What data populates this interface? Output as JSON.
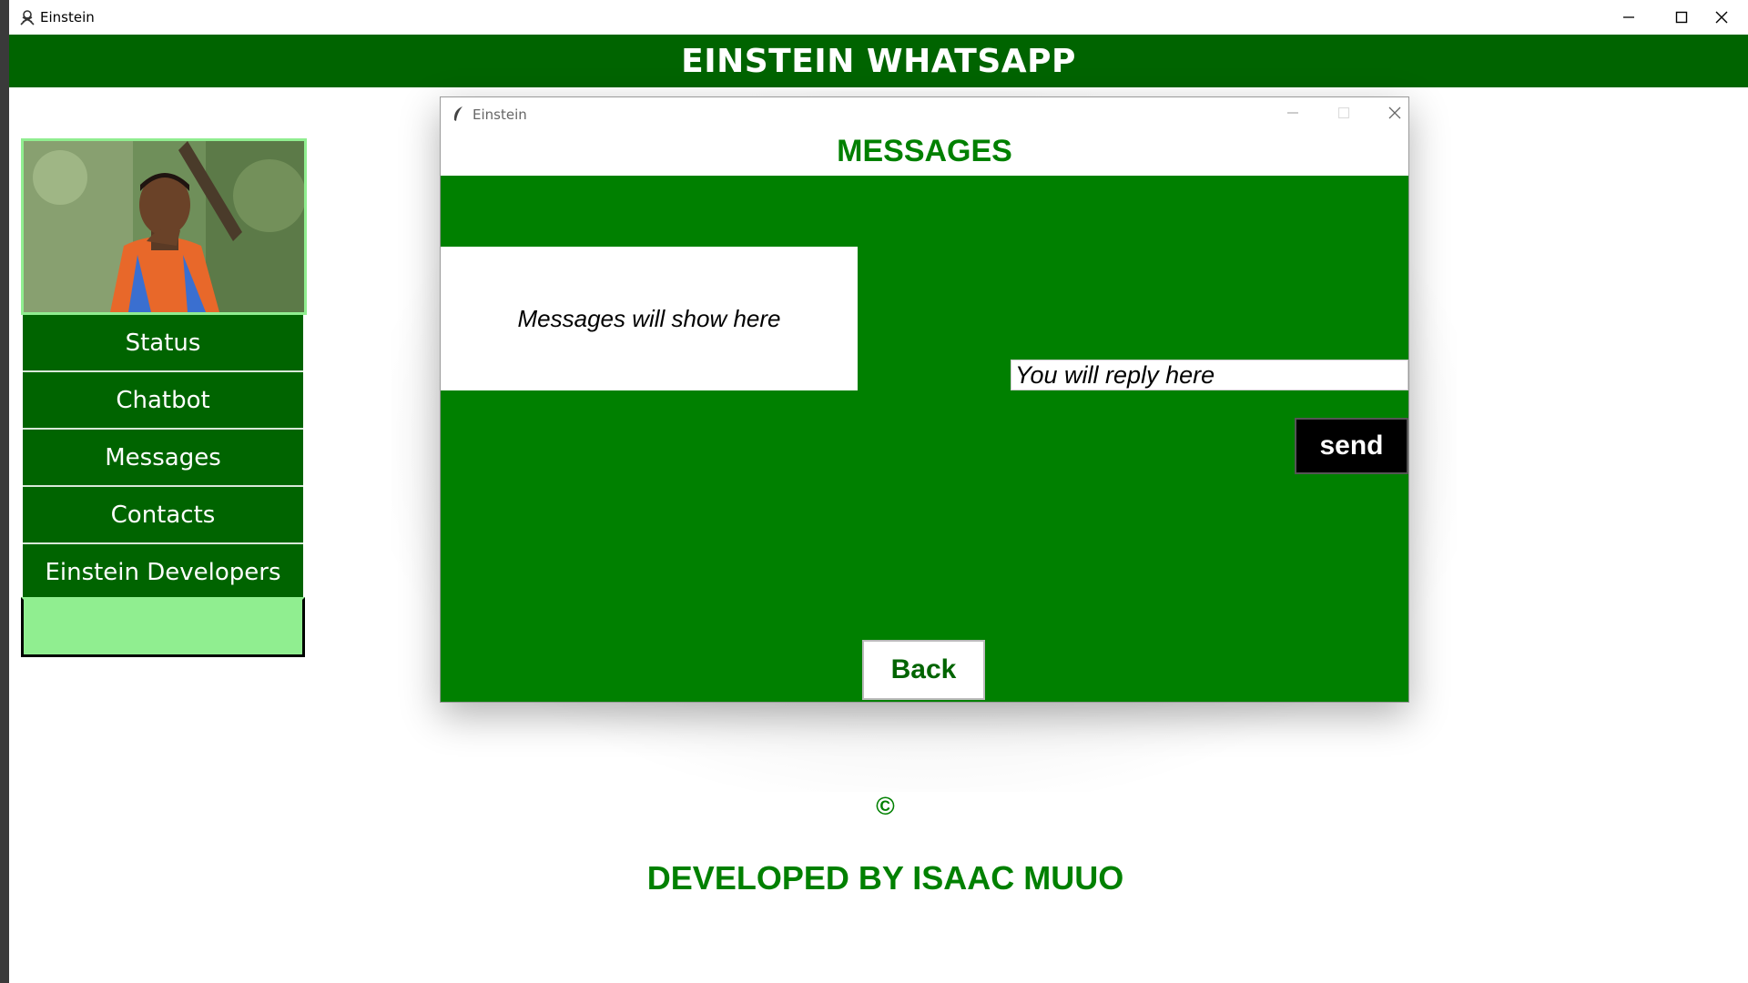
{
  "window": {
    "title": "Einstein"
  },
  "header": {
    "title": "EINSTEIN WHATSAPP"
  },
  "sidebar": {
    "avatar_icon": "profile-photo",
    "items": [
      {
        "label": "Status"
      },
      {
        "label": "Chatbot"
      },
      {
        "label": "Messages"
      },
      {
        "label": "Contacts"
      },
      {
        "label": "Einstein Developers"
      }
    ]
  },
  "dialog": {
    "title": "Einstein",
    "heading": "MESSAGES",
    "messages_placeholder": "Messages will show here",
    "reply_placeholder": "You will reply here",
    "send_label": "send",
    "back_label": "Back"
  },
  "footer": {
    "copyright": "©",
    "credit": "DEVELOPED BY ISAAC MUUO"
  },
  "colors": {
    "dark_green": "#006400",
    "green": "#008000",
    "light_green": "#90ee90",
    "send_bg": "#000000"
  }
}
